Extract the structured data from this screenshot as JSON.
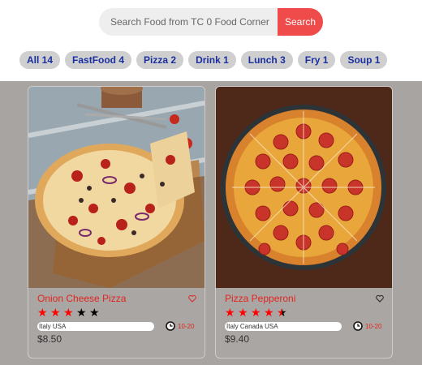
{
  "search": {
    "placeholder": "Search Food from TC 0 Food Corner",
    "button_label": "Search"
  },
  "categories": [
    {
      "label": "All 14"
    },
    {
      "label": "FastFood 4"
    },
    {
      "label": "Pizza 2"
    },
    {
      "label": "Drink 1"
    },
    {
      "label": "Lunch 3"
    },
    {
      "label": "Fry 1"
    },
    {
      "label": "Soup 1"
    }
  ],
  "items": [
    {
      "name": "Onion Cheese Pizza",
      "rating": 3,
      "origin": "Italy USA",
      "time": "10-20",
      "price": "$8.50",
      "icon": "heart-icon"
    },
    {
      "name": "Pizza Pepperoni",
      "rating": 4.5,
      "origin": "Italy Canada USA",
      "time": "10-20",
      "price": "$9.40",
      "icon": "heart-icon"
    }
  ],
  "colors": {
    "accent": "#ef4b4b",
    "chip_text": "#1a2fa0",
    "title_text": "#e0261f",
    "content_bg": "#a8a4a2"
  }
}
